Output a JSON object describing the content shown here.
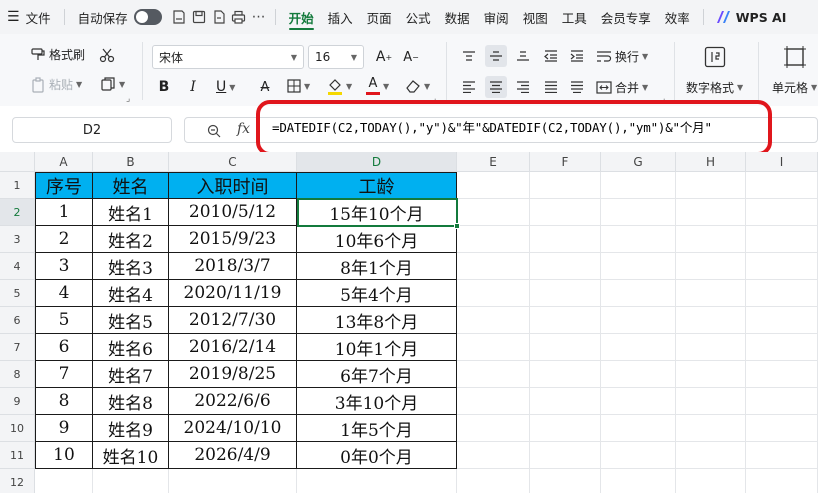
{
  "menubar": {
    "file": "文件",
    "autosave": "自动保存",
    "tabs": [
      "开始",
      "插入",
      "页面",
      "公式",
      "数据",
      "审阅",
      "视图",
      "工具",
      "会员专享",
      "效率"
    ],
    "ai": "WPS AI"
  },
  "ribbon": {
    "format_painter": "格式刷",
    "paste": "粘贴",
    "font_name": "宋体",
    "font_size": "16",
    "bold": "B",
    "italic": "I",
    "underline": "U",
    "wrap": "换行",
    "merge": "合并",
    "number_format": "数字格式",
    "cell": "单元格"
  },
  "formula_bar": {
    "name_box": "D2",
    "fx": "fx",
    "formula": "=DATEDIF(C2,TODAY(),\"y\")&\"年\"&DATEDIF(C2,TODAY(),\"ym\")&\"个月\""
  },
  "sheet": {
    "columns": [
      "A",
      "B",
      "C",
      "D",
      "E",
      "F",
      "G",
      "H",
      "I"
    ],
    "rows": [
      "1",
      "2",
      "3",
      "4",
      "5",
      "6",
      "7",
      "8",
      "9",
      "10",
      "11",
      "12"
    ],
    "header": [
      "序号",
      "姓名",
      "入职时间",
      "工龄"
    ],
    "data": [
      [
        "1",
        "姓名1",
        "2010/5/12",
        "15年10个月"
      ],
      [
        "2",
        "姓名2",
        "2015/9/23",
        "10年6个月"
      ],
      [
        "3",
        "姓名3",
        "2018/3/7",
        "8年1个月"
      ],
      [
        "4",
        "姓名4",
        "2020/11/19",
        "5年4个月"
      ],
      [
        "5",
        "姓名5",
        "2012/7/30",
        "13年8个月"
      ],
      [
        "6",
        "姓名6",
        "2016/2/14",
        "10年1个月"
      ],
      [
        "7",
        "姓名7",
        "2019/8/25",
        "6年7个月"
      ],
      [
        "8",
        "姓名8",
        "2022/6/6",
        "3年10个月"
      ],
      [
        "9",
        "姓名9",
        "2024/10/10",
        "1年5个月"
      ],
      [
        "10",
        "姓名10",
        "2026/4/9",
        "0年0个月"
      ]
    ]
  },
  "colors": {
    "accent": "#137a3c",
    "header_fill": "#00b0f0",
    "highlight": "#e0161c"
  }
}
